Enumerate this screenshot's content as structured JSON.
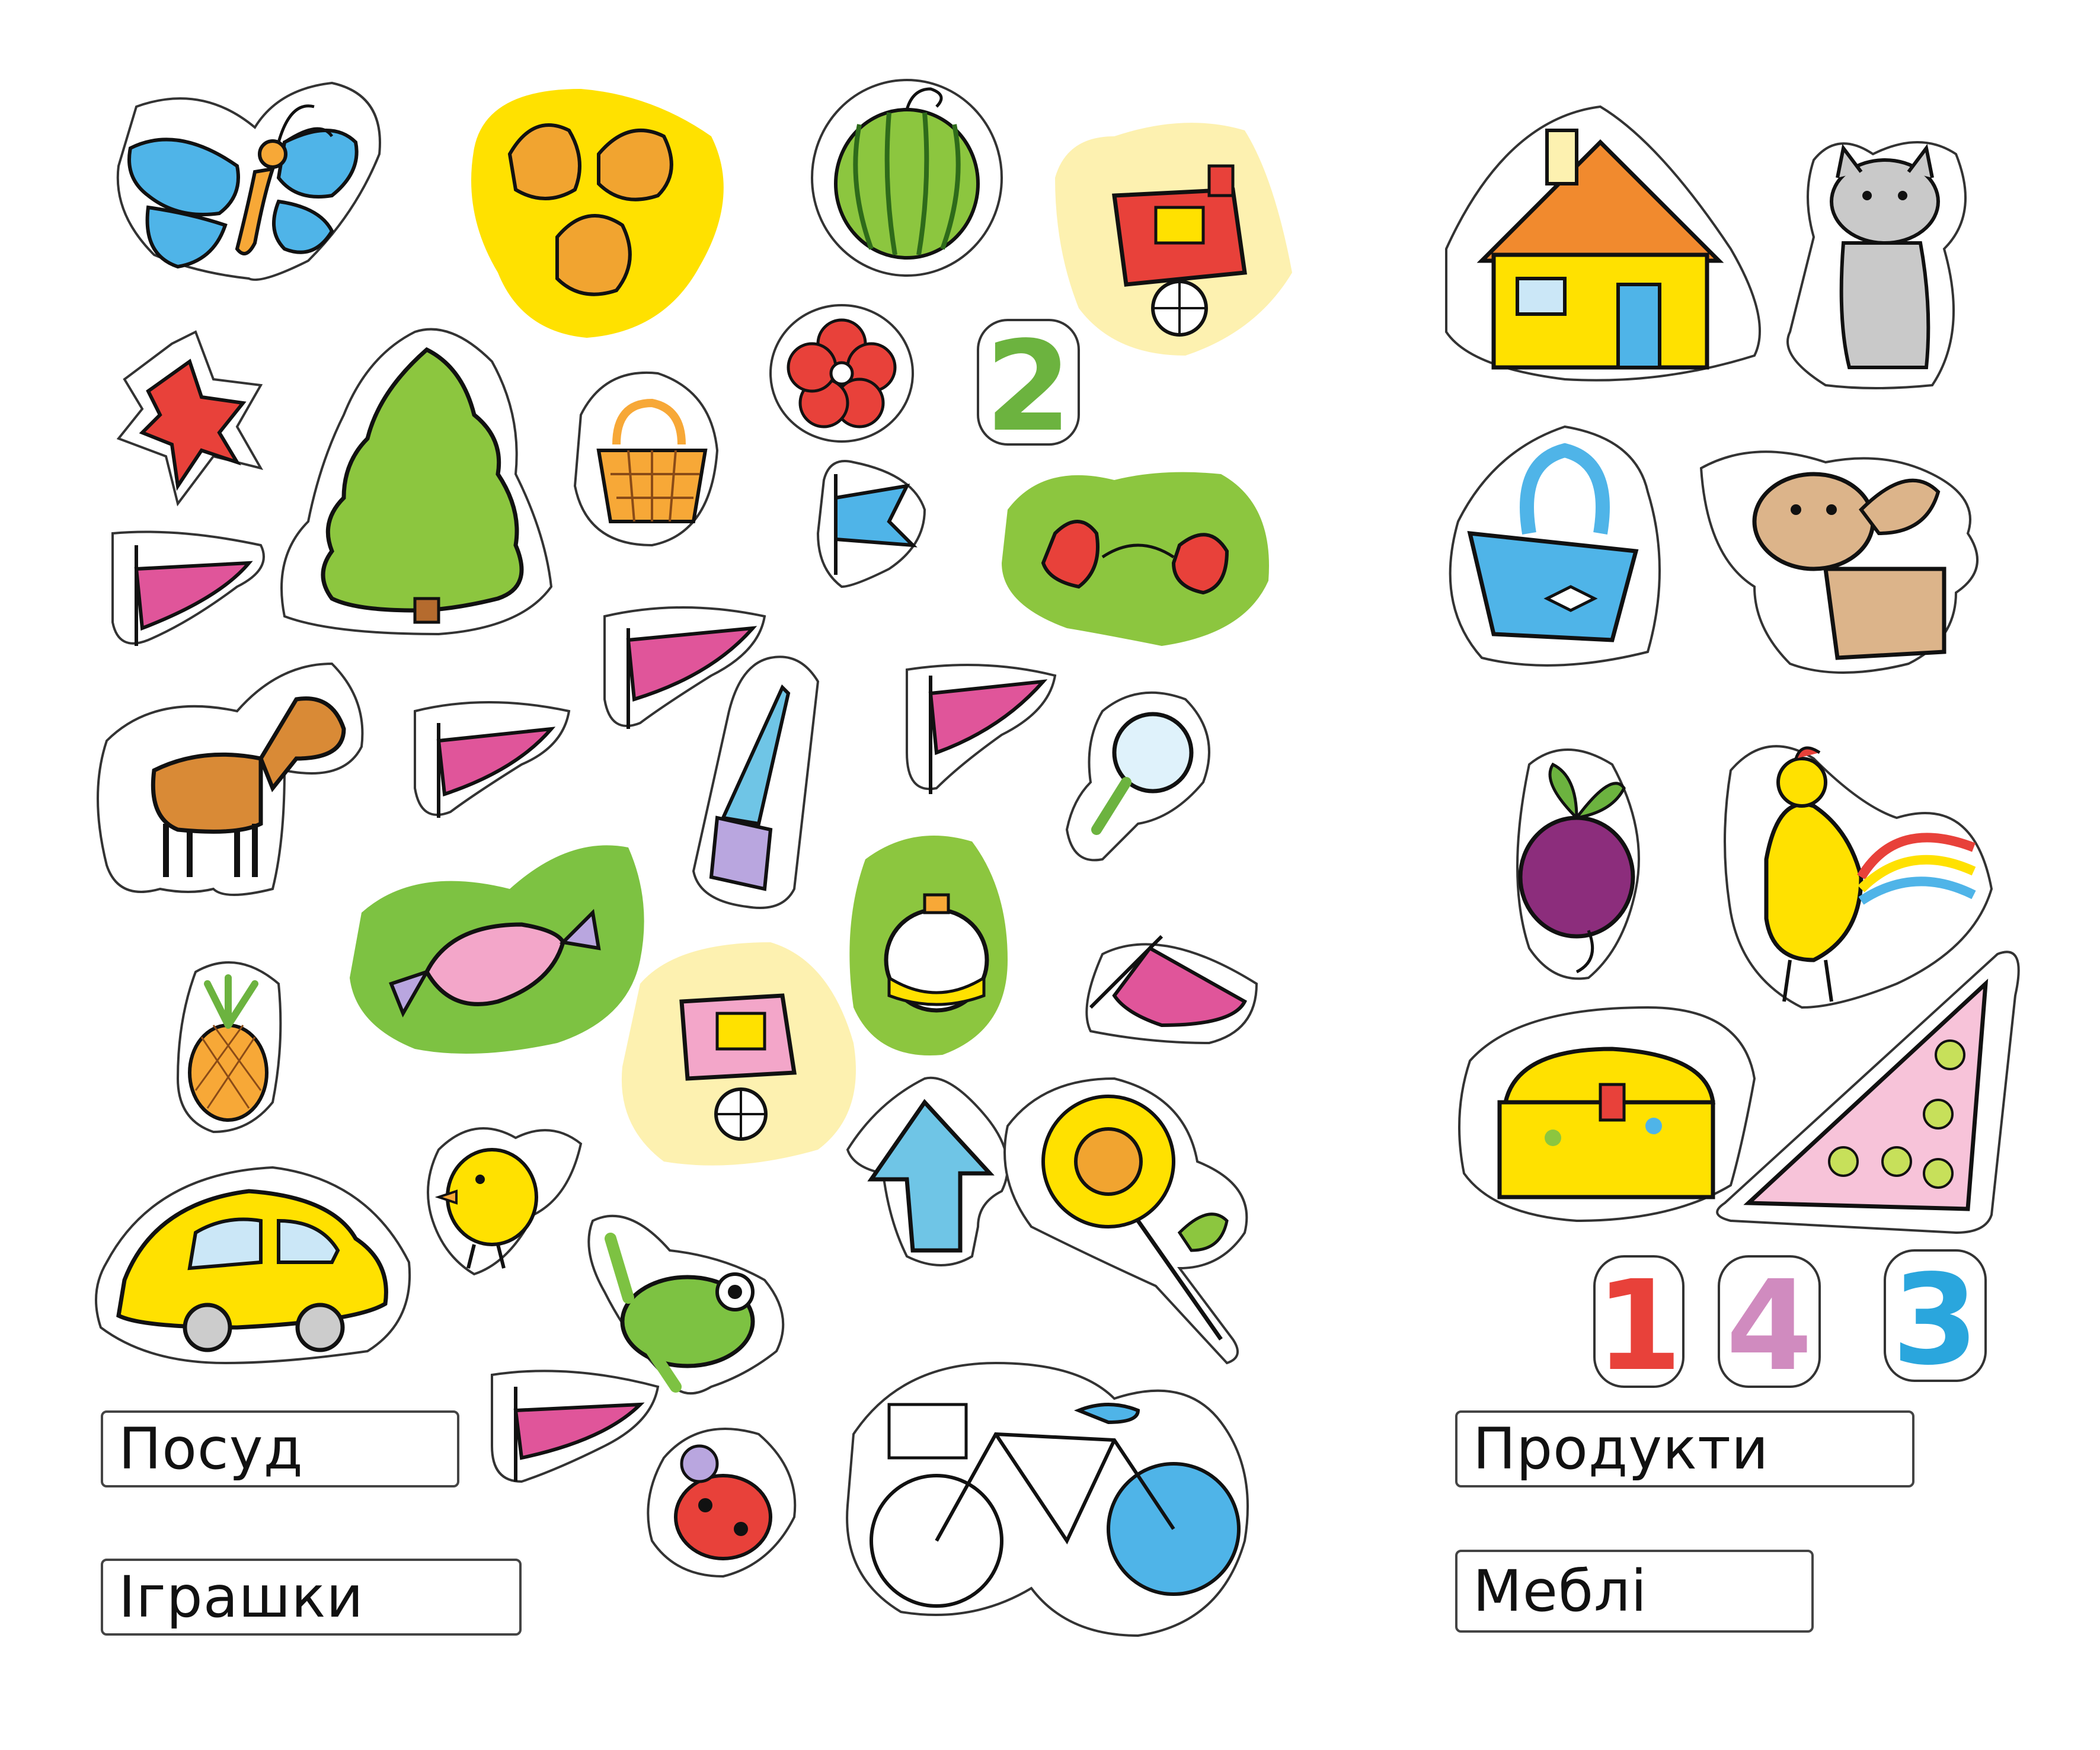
{
  "labels": {
    "posud": "Посуд",
    "igrashky": "Іграшки",
    "produkty": "Продукти",
    "mebli": "Меблі"
  },
  "numbers": {
    "two": "2",
    "one": "1",
    "four": "4",
    "three": "3"
  },
  "colors": {
    "green_number": "#6cb33f",
    "red_number": "#e8413a",
    "pink_number": "#d08bbf",
    "blue_number": "#2aa6dd",
    "pennant_pink": "#e0559a",
    "sky_blue": "#4fb4e8",
    "leaf_green": "#8cc63f",
    "sun_yellow": "#ffe100"
  },
  "icons": [
    "butterfly",
    "onions",
    "watermelon",
    "red-wagon",
    "star",
    "flower",
    "number-two",
    "tree",
    "basket",
    "blue-flag",
    "strawberries",
    "pennant",
    "horse",
    "saw",
    "magnifier",
    "candy",
    "ornament",
    "pineapple",
    "pink-wagon",
    "arrow-up",
    "sunflower",
    "chick",
    "frog",
    "car",
    "ladybug",
    "bicycle",
    "house",
    "cat",
    "bucket",
    "dog",
    "beet",
    "rooster",
    "treasure-chest",
    "triangle"
  ]
}
